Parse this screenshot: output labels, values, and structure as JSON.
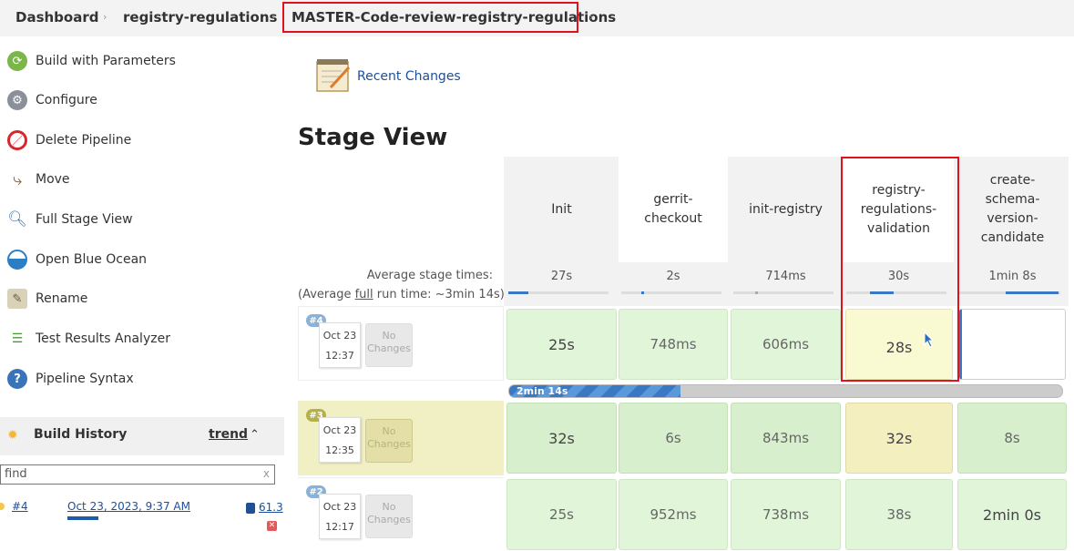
{
  "breadcrumb": {
    "items": [
      "Dashboard",
      "registry-regulations",
      "MASTER-Code-review-registry-regulations"
    ],
    "separator": "›"
  },
  "sidebar": {
    "items": [
      {
        "label": "Build with Parameters",
        "icon": "build-parameters-icon"
      },
      {
        "label": "Configure",
        "icon": "gear-icon"
      },
      {
        "label": "Delete Pipeline",
        "icon": "no-entry-icon"
      },
      {
        "label": "Move",
        "icon": "move-icon"
      },
      {
        "label": "Full Stage View",
        "icon": "magnifier-icon"
      },
      {
        "label": "Open Blue Ocean",
        "icon": "blue-ocean-icon"
      },
      {
        "label": "Rename",
        "icon": "rename-icon"
      },
      {
        "label": "Test Results Analyzer",
        "icon": "test-results-icon"
      },
      {
        "label": "Pipeline Syntax",
        "icon": "help-icon"
      }
    ],
    "build_history": {
      "title": "Build History",
      "trend": "trend",
      "find_placeholder": "find",
      "clear": "x",
      "entry": {
        "number": "#4",
        "date": "Oct 23, 2023, 9:37 AM",
        "size": "61.3"
      }
    }
  },
  "main": {
    "recent_changes": "Recent Changes",
    "stage_view_title": "Stage View",
    "avg_label": "Average stage times:",
    "avg_run_prefix": "(Average ",
    "avg_run_link": "full",
    "avg_run_suffix": " run time: ~3min 14s)",
    "stages": [
      {
        "name": "Init",
        "avg": "27s"
      },
      {
        "name": "gerrit-checkout",
        "avg": "2s"
      },
      {
        "name": "init-registry",
        "avg": "714ms"
      },
      {
        "name": "registry-regulations-validation",
        "avg": "30s"
      },
      {
        "name": "create-schema-version-candidate",
        "avg": "1min 8s"
      }
    ],
    "builds": [
      {
        "number": "#4",
        "date": "Oct 23",
        "time": "12:37",
        "changes": "No Changes",
        "cells": [
          "25s",
          "748ms",
          "606ms",
          "28s",
          ""
        ],
        "progress_label": "2min 14s",
        "progress": 0.31
      },
      {
        "number": "#3",
        "date": "Oct 23",
        "time": "12:35",
        "changes": "No Changes",
        "cells": [
          "32s",
          "6s",
          "843ms",
          "32s",
          "8s"
        ]
      },
      {
        "number": "#2",
        "date": "Oct 23",
        "time": "12:17",
        "changes": "No Changes",
        "cells": [
          "25s",
          "952ms",
          "738ms",
          "38s",
          "2min 0s"
        ]
      }
    ]
  },
  "colors": {
    "highlight_red": "#e0121c",
    "success_green": "#e1f5d9",
    "success_green_dark": "#d3ecca",
    "unstable_yellow": "#f7f3c9",
    "progress_blue": "#4a90d9"
  }
}
